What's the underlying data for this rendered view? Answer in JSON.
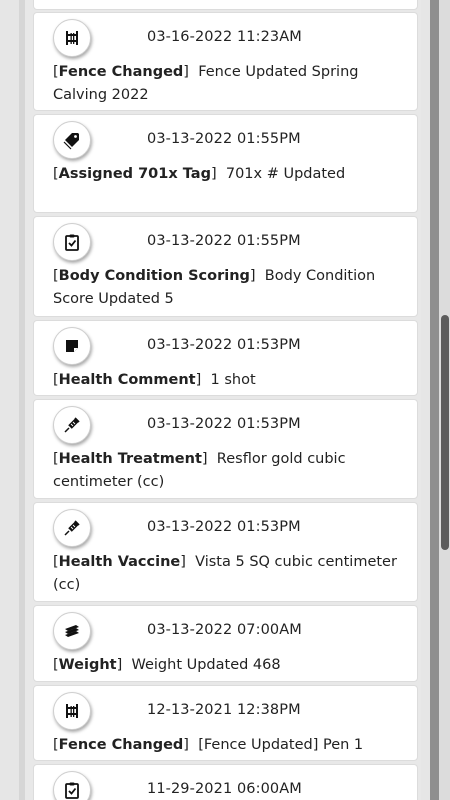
{
  "entries": [
    {
      "icon": "fence-icon",
      "timestamp": "03-16-2022 11:23AM",
      "category": "Fence Changed",
      "detail": "Fence Updated Spring Calving 2022"
    },
    {
      "icon": "tag-icon",
      "timestamp": "03-13-2022 01:55PM",
      "category": "Assigned 701x Tag",
      "detail": "701x # Updated"
    },
    {
      "icon": "clipboard-check-icon",
      "timestamp": "03-13-2022 01:55PM",
      "category": "Body Condition Scoring",
      "detail": "Body Condition Score Updated 5"
    },
    {
      "icon": "note-icon",
      "timestamp": "03-13-2022 01:53PM",
      "category": "Health Comment",
      "detail": "1 shot"
    },
    {
      "icon": "syringe-icon",
      "timestamp": "03-13-2022 01:53PM",
      "category": "Health Treatment",
      "detail": "Resflor gold cubic centimeter (cc)"
    },
    {
      "icon": "syringe-icon",
      "timestamp": "03-13-2022 01:53PM",
      "category": "Health Vaccine",
      "detail": "Vista 5 SQ cubic centimeter (cc)"
    },
    {
      "icon": "scale-icon",
      "timestamp": "03-13-2022 07:00AM",
      "category": "Weight",
      "detail": "Weight Updated 468"
    },
    {
      "icon": "fence-icon",
      "timestamp": "12-13-2021 12:38PM",
      "category": "Fence Changed",
      "detail": "[Fence Updated] Pen 1"
    },
    {
      "icon": "clipboard-check-icon",
      "timestamp": "11-29-2021 06:00AM",
      "category": "",
      "detail": ""
    }
  ]
}
